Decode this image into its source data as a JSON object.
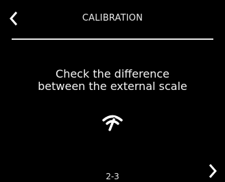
{
  "header": {
    "title": "CALIBRATION",
    "back_icon": "chevron-left-icon"
  },
  "main": {
    "instruction_line1": "Check the difference",
    "instruction_line2": "between the external scale",
    "icon": "scale-pressure-icon"
  },
  "footer": {
    "page_indicator": "2-3",
    "next_icon": "chevron-right-icon"
  },
  "colors": {
    "background": "#000000",
    "foreground": "#f2f2f2"
  }
}
